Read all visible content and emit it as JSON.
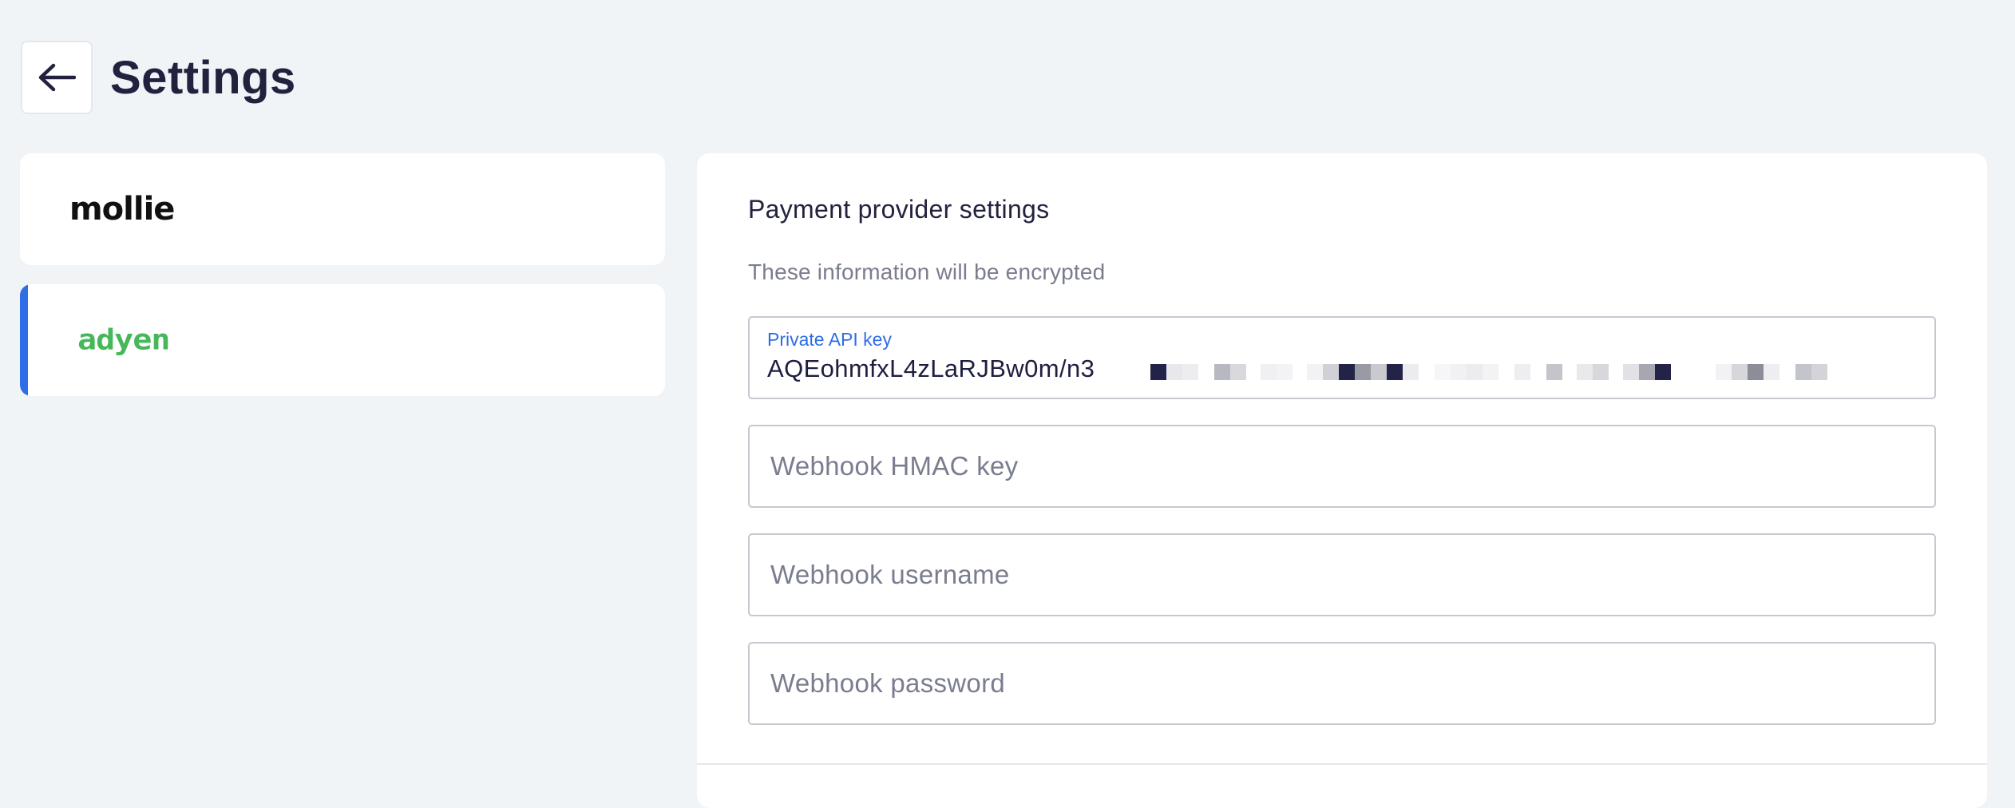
{
  "header": {
    "title": "Settings",
    "back_icon": "arrow-left-icon"
  },
  "providers": [
    {
      "name": "mollie",
      "logo_text": "mollie",
      "selected": false
    },
    {
      "name": "adyen",
      "logo_text": "adyen",
      "selected": true,
      "accent_color": "#2f6de6",
      "logo_color": "#46b85a"
    }
  ],
  "panel": {
    "heading": "Payment provider settings",
    "subtext": "These information will be encrypted",
    "fields": {
      "api_key": {
        "label": "Private API key",
        "value": "AQEohmfxL4zLaRJBw0m/n3"
      },
      "hmac": {
        "placeholder": "Webhook HMAC key",
        "value": ""
      },
      "username": {
        "placeholder": "Webhook username",
        "value": ""
      },
      "password": {
        "placeholder": "Webhook password",
        "value": ""
      }
    }
  },
  "colors": {
    "background": "#f0f4f7",
    "accent": "#2f6de6",
    "text_primary": "#22223f",
    "text_muted": "#7a7d8f",
    "adyen_green": "#46b85a"
  }
}
